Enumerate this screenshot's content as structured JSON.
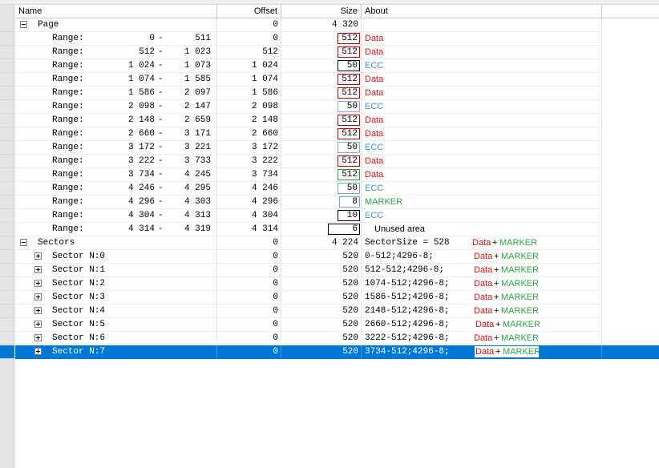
{
  "columns": {
    "name": "Name",
    "offset": "Offset",
    "size": "Size",
    "about": "About"
  },
  "colors": {
    "data": "#dd1111",
    "ecc": "#3d8fd6",
    "marker": "#2aa84a",
    "selection": "#0078d7"
  },
  "page": {
    "name": "Page",
    "offset": "0",
    "size": "4 320"
  },
  "ranges": [
    {
      "name": "Range:",
      "from": "0",
      "to": "511",
      "offset": "0",
      "size": "512",
      "about": "Data",
      "kind": "data",
      "box": "red"
    },
    {
      "name": "Range:",
      "from": "512",
      "to": "1 023",
      "offset": "512",
      "size": "512",
      "about": "Data",
      "kind": "data",
      "box": "red"
    },
    {
      "name": "Range:",
      "from": "1 024",
      "to": "1 073",
      "offset": "1 024",
      "size": "50",
      "about": "ECC",
      "kind": "ecc",
      "box": "black"
    },
    {
      "name": "Range:",
      "from": "1 074",
      "to": "1 585",
      "offset": "1 074",
      "size": "512",
      "about": "Data",
      "kind": "data",
      "box": "red"
    },
    {
      "name": "Range:",
      "from": "1 586",
      "to": "2 097",
      "offset": "1 586",
      "size": "512",
      "about": "Data",
      "kind": "data",
      "box": "red"
    },
    {
      "name": "Range:",
      "from": "2 098",
      "to": "2 147",
      "offset": "2 098",
      "size": "50",
      "about": "ECC",
      "kind": "ecc",
      "box": "lightblue"
    },
    {
      "name": "Range:",
      "from": "2 148",
      "to": "2 659",
      "offset": "2 148",
      "size": "512",
      "about": "Data",
      "kind": "data",
      "box": "red"
    },
    {
      "name": "Range:",
      "from": "2 660",
      "to": "3 171",
      "offset": "2 660",
      "size": "512",
      "about": "Data",
      "kind": "data",
      "box": "red"
    },
    {
      "name": "Range:",
      "from": "3 172",
      "to": "3 221",
      "offset": "3 172",
      "size": "50",
      "about": "ECC",
      "kind": "ecc",
      "box": "lightblue"
    },
    {
      "name": "Range:",
      "from": "3 222",
      "to": "3 733",
      "offset": "3 222",
      "size": "512",
      "about": "Data",
      "kind": "data",
      "box": "red"
    },
    {
      "name": "Range:",
      "from": "3 734",
      "to": "4 245",
      "offset": "3 734",
      "size": "512",
      "about": "Data",
      "kind": "data",
      "box": "green"
    },
    {
      "name": "Range:",
      "from": "4 246",
      "to": "4 295",
      "offset": "4 246",
      "size": "50",
      "about": "ECC",
      "kind": "ecc",
      "box": "teal"
    },
    {
      "name": "Range:",
      "from": "4 296",
      "to": "4 303",
      "offset": "4 296",
      "size": "8",
      "about": "MARKER",
      "kind": "marker",
      "box": "teal"
    },
    {
      "name": "Range:",
      "from": "4 304",
      "to": "4 313",
      "offset": "4 304",
      "size": "10",
      "about": "ECC",
      "kind": "ecc",
      "box": "black"
    },
    {
      "name": "Range:",
      "from": "4 314",
      "to": "4 319",
      "offset": "4 314",
      "size": "6",
      "about": "Unused area",
      "kind": "unused",
      "box": "black"
    }
  ],
  "sectors": {
    "name": "Sectors",
    "offset": "0",
    "size": "4 224",
    "about": "SectorSize = 528",
    "tag_a": "Data",
    "tag_plus": " + ",
    "tag_b": "MARKER"
  },
  "sector_items": [
    {
      "name": "Sector N:0",
      "offset": "0",
      "size": "520",
      "about": "0-512;4296-8;",
      "tag_a": "Data",
      "tag_plus": " + ",
      "tag_b": "MARKER"
    },
    {
      "name": "Sector N:1",
      "offset": "0",
      "size": "520",
      "about": "512-512;4296-8;",
      "tag_a": "Data",
      "tag_plus": " + ",
      "tag_b": "MARKER"
    },
    {
      "name": "Sector N:2",
      "offset": "0",
      "size": "520",
      "about": "1074-512;4296-8;",
      "tag_a": "Data",
      "tag_plus": " + ",
      "tag_b": "MARKER"
    },
    {
      "name": "Sector N:3",
      "offset": "0",
      "size": "520",
      "about": "1586-512;4296-8;",
      "tag_a": "Data",
      "tag_plus": " + ",
      "tag_b": "MARKER"
    },
    {
      "name": "Sector N:4",
      "offset": "0",
      "size": "520",
      "about": "2148-512;4296-8;",
      "tag_a": "Data",
      "tag_plus": " + ",
      "tag_b": "MARKER"
    },
    {
      "name": "Sector N:5",
      "offset": "0",
      "size": "520",
      "about": "2660-512;4296-8;",
      "tag_a": "Data",
      "tag_plus": " + ",
      "tag_b": "MARKER"
    },
    {
      "name": "Sector N:6",
      "offset": "0",
      "size": "520",
      "about": "3222-512;4296-8;",
      "tag_a": "Data",
      "tag_plus": " + ",
      "tag_b": "MARKER"
    },
    {
      "name": "Sector N:7",
      "offset": "0",
      "size": "520",
      "about": "3734-512;4296-8;",
      "tag_a": "Data",
      "tag_plus": " + ",
      "tag_b": "MARKER",
      "selected": true
    }
  ]
}
